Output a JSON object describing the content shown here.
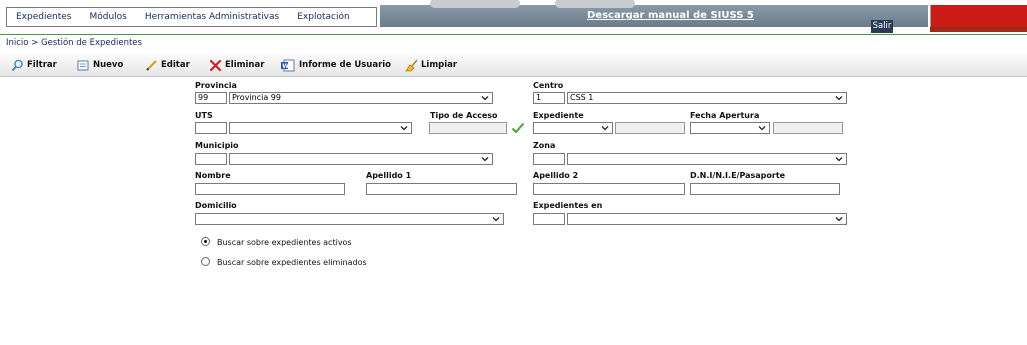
{
  "menu": {
    "items": [
      "Expedientes",
      "Módulos",
      "Herramientas Administrativas",
      "Explotación"
    ]
  },
  "header": {
    "download_link": "Descargar manual de SIUSS 5",
    "logout_label": "Salir"
  },
  "breadcrumb": "Inicio > Gestión de Expedientes",
  "toolbar": {
    "filter": "Filtrar",
    "new": "Nuevo",
    "edit": "Editar",
    "delete": "Eliminar",
    "user_report": "Informe de Usuario",
    "clear": "Limpiar"
  },
  "form": {
    "provincia": {
      "label": "Provincia",
      "code": "99",
      "value": "Provincia 99"
    },
    "centro": {
      "label": "Centro",
      "code": "1",
      "value": "CSS 1"
    },
    "uts": {
      "label": "UTS",
      "code": "",
      "value": ""
    },
    "tipo_acceso": {
      "label": "Tipo de Acceso",
      "value": ""
    },
    "expediente": {
      "label": "Expediente",
      "value": "",
      "number": ""
    },
    "fecha_apertura": {
      "label": "Fecha Apertura",
      "value": "",
      "text": ""
    },
    "municipio": {
      "label": "Municipio",
      "code": "",
      "value": ""
    },
    "zona": {
      "label": "Zona",
      "code": "",
      "value": ""
    },
    "nombre": {
      "label": "Nombre",
      "value": ""
    },
    "apellido1": {
      "label": "Apellido 1",
      "value": ""
    },
    "apellido2": {
      "label": "Apellido 2",
      "value": ""
    },
    "dni": {
      "label": "D.N.I/N.I.E/Pasaporte",
      "value": ""
    },
    "domicilio": {
      "label": "Domicilio",
      "value": ""
    },
    "expedientes_en": {
      "label": "Expedientes en",
      "code": "",
      "value": ""
    }
  },
  "search_scope": {
    "options": [
      "Buscar sobre expedientes activos",
      "Buscar sobre expedientes eliminados"
    ],
    "selected": "Buscar sobre expedientes activos"
  },
  "colors": {
    "accent_green": "#4a9a4a",
    "link_blue": "#1a2a6a",
    "logout_bg": "#2a3a56",
    "brand_red": "#cc1a14"
  }
}
